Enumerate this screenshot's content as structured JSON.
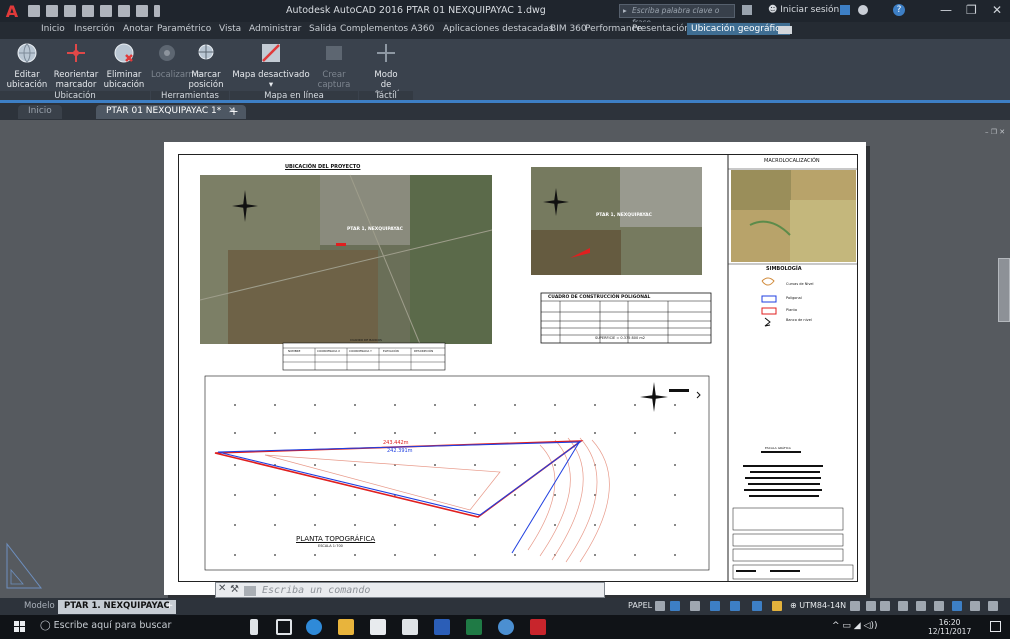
{
  "titlebar": {
    "app_glyph": "A",
    "title": "Autodesk AutoCAD 2016   PTAR 01 NEXQUIPAYAC 1.dwg",
    "search_placeholder": "Escriba palabra clave o frase",
    "login": "Iniciar sesión",
    "minimize": "—",
    "restore": "❐",
    "close": "✕"
  },
  "ribbon_tabs": [
    "Inicio",
    "Inserción",
    "Anotar",
    "Paramétrico",
    "Vista",
    "Administrar",
    "Salida",
    "Complementos",
    "A360",
    "Aplicaciones destacadas",
    "BIM 360",
    "Performance",
    "Presentación",
    "Ubicación geográfica"
  ],
  "ribbon": {
    "groups": [
      {
        "label": "Ubicación",
        "buttons": [
          [
            "Editar",
            "ubicación"
          ],
          [
            "Reorientar",
            "marcador"
          ],
          [
            "Eliminar",
            "ubicación"
          ]
        ]
      },
      {
        "label": "Herramientas",
        "buttons": [
          [
            "Localizarme",
            ""
          ],
          [
            "Marcar",
            "posición"
          ]
        ]
      },
      {
        "label": "Mapa en línea",
        "buttons": [
          [
            "Mapa desactivado",
            ""
          ],
          [
            "Crear",
            "captura"
          ]
        ]
      },
      {
        "label": "Táctil",
        "buttons": [
          [
            "Modo",
            "de selección"
          ]
        ]
      }
    ]
  },
  "doc_tabs": [
    "Inicio",
    "PTAR 01 NEXQUIPAYAC 1*"
  ],
  "drawing": {
    "ubicacion_title": "UBICACIÓN DEL PROYECTO",
    "macro_title": "MACROLOCALIZACIÓN",
    "simbologia": "SIMBOLOGÍA",
    "legend": [
      "Curvas de Nivel",
      "Poligonal",
      "Planta",
      "Banco de nivel"
    ],
    "map_label_1": "PTAR 1, NEXQUIPAYAC",
    "map_label_2": "PTAR 1, NEXQUIPAYAC",
    "cuadro_title": "CUADRO DE CONSTRUCCIÓN POLIGONAL",
    "superficie": "SUPERFICIE = 0.375 800 m2",
    "bancos_title": "CUADRO DE BANCOS",
    "bancos_headers": [
      "NOMBRE",
      "COORDENADA X",
      "COORDENADA Y",
      "ELEVACIÓN",
      "DESCRIPCIÓN"
    ],
    "planta_title": "PLANTA TOPOGRÁFICA",
    "planta_scale": "ESCALA 1:700",
    "dim_1": "243.442m",
    "dim_2": "242.391m",
    "escala_grafica": "ESCALA GRÁFICA"
  },
  "command": {
    "placeholder": "Escriba un comando",
    "close_glyph": "✕"
  },
  "layout_tabs": [
    "Modelo",
    "PTAR 1. NEXQUIPAYAC"
  ],
  "status": {
    "papel": "PAPEL",
    "coord_system": "UTM84-14N"
  },
  "taskbar": {
    "search": "Escribe aquí para buscar",
    "time": "16:20",
    "date": "12/11/2017"
  },
  "colors": {
    "accent": "#3d7fc5",
    "titlebar": "#1f252d",
    "ribbon": "#3a424d",
    "canvas": "#565a5f",
    "polygon_red": "#e01f1f",
    "polygon_blue": "#1f3fe0",
    "contour": "#e89a8a"
  }
}
